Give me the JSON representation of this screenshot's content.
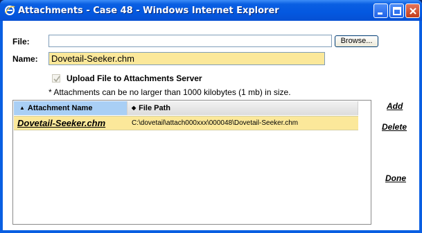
{
  "window": {
    "title": "Attachments - Case 48 - Windows Internet Explorer"
  },
  "form": {
    "file_label": "File:",
    "file_value": "",
    "browse_label": "Browse...",
    "name_label": "Name:",
    "name_value": "Dovetail-Seeker.chm",
    "upload_checkbox_label": "Upload File to Attachments Server",
    "upload_checked": true,
    "size_note": "* Attachments can be no larger than 1000 kilobytes (1 mb) in size."
  },
  "grid": {
    "columns": [
      {
        "label": "Attachment Name",
        "sort_icon": "sort-asc-icon"
      },
      {
        "label": "File Path",
        "sort_icon": "sort-both-icon"
      }
    ],
    "rows": [
      {
        "name": "Dovetail-Seeker.chm",
        "path": "C:\\dovetail\\attach000xxx\\000048\\Dovetail-Seeker.chm"
      }
    ]
  },
  "actions": {
    "add": "Add",
    "delete": "Delete",
    "done": "Done"
  },
  "colors": {
    "highlight": "#fbe89a",
    "header_selected": "#a9cff5",
    "titlebar": "#0458e0"
  }
}
